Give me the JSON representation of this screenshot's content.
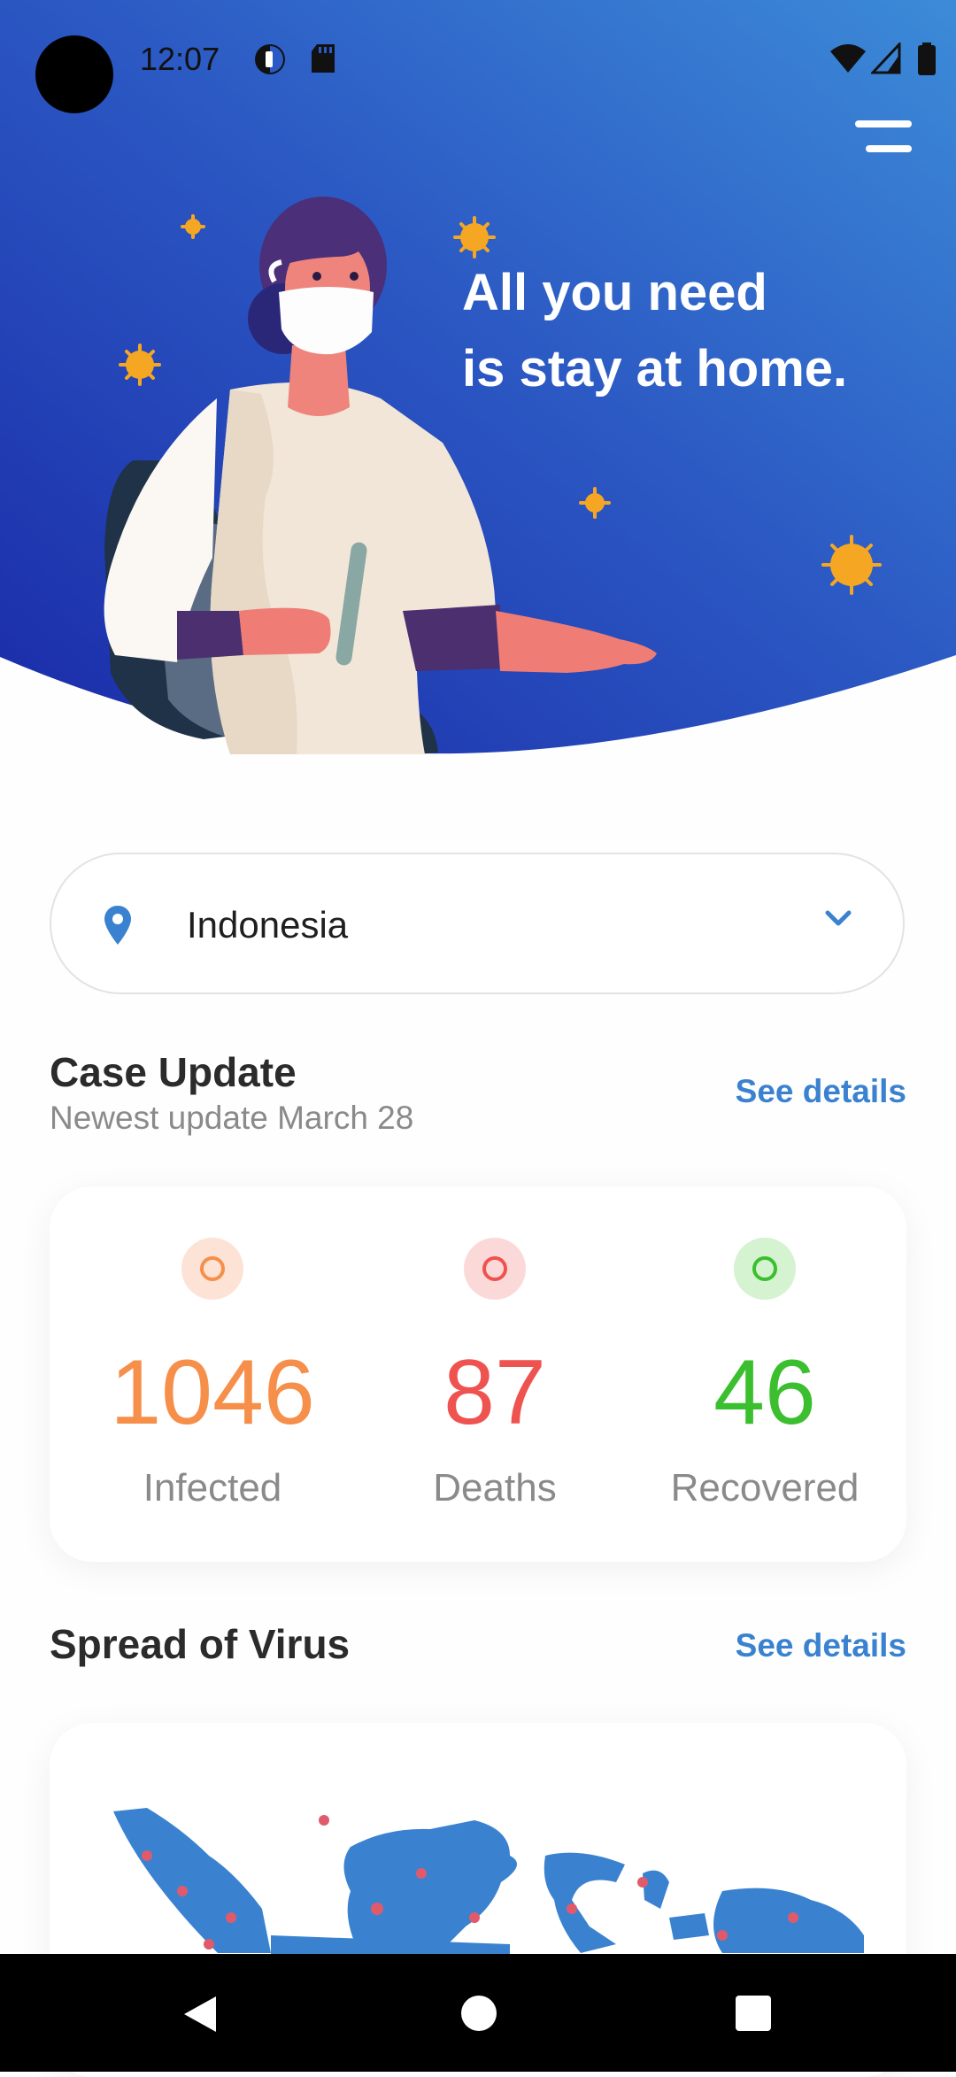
{
  "status_bar": {
    "time": "12:07"
  },
  "hero": {
    "headline_line1": "All you need",
    "headline_line2": "is stay at home."
  },
  "country_selector": {
    "value": "Indonesia"
  },
  "case_update": {
    "title": "Case Update",
    "subtitle": "Newest update March 28",
    "see_details": "See details"
  },
  "stats": [
    {
      "value": "1046",
      "label": "Infected",
      "color": "#f68f4a",
      "bg": "#fde2d6"
    },
    {
      "value": "87",
      "label": "Deaths",
      "color": "#ef5350",
      "bg": "#fcd9d9"
    },
    {
      "value": "46",
      "label": "Recovered",
      "color": "#3bbf2f",
      "bg": "#d5f2d1"
    }
  ],
  "spread": {
    "title": "Spread of Virus",
    "see_details": "See details"
  },
  "colors": {
    "hero_start": "#1a2fb2",
    "hero_end": "#3f8ad8",
    "accent": "#3a82cf"
  }
}
